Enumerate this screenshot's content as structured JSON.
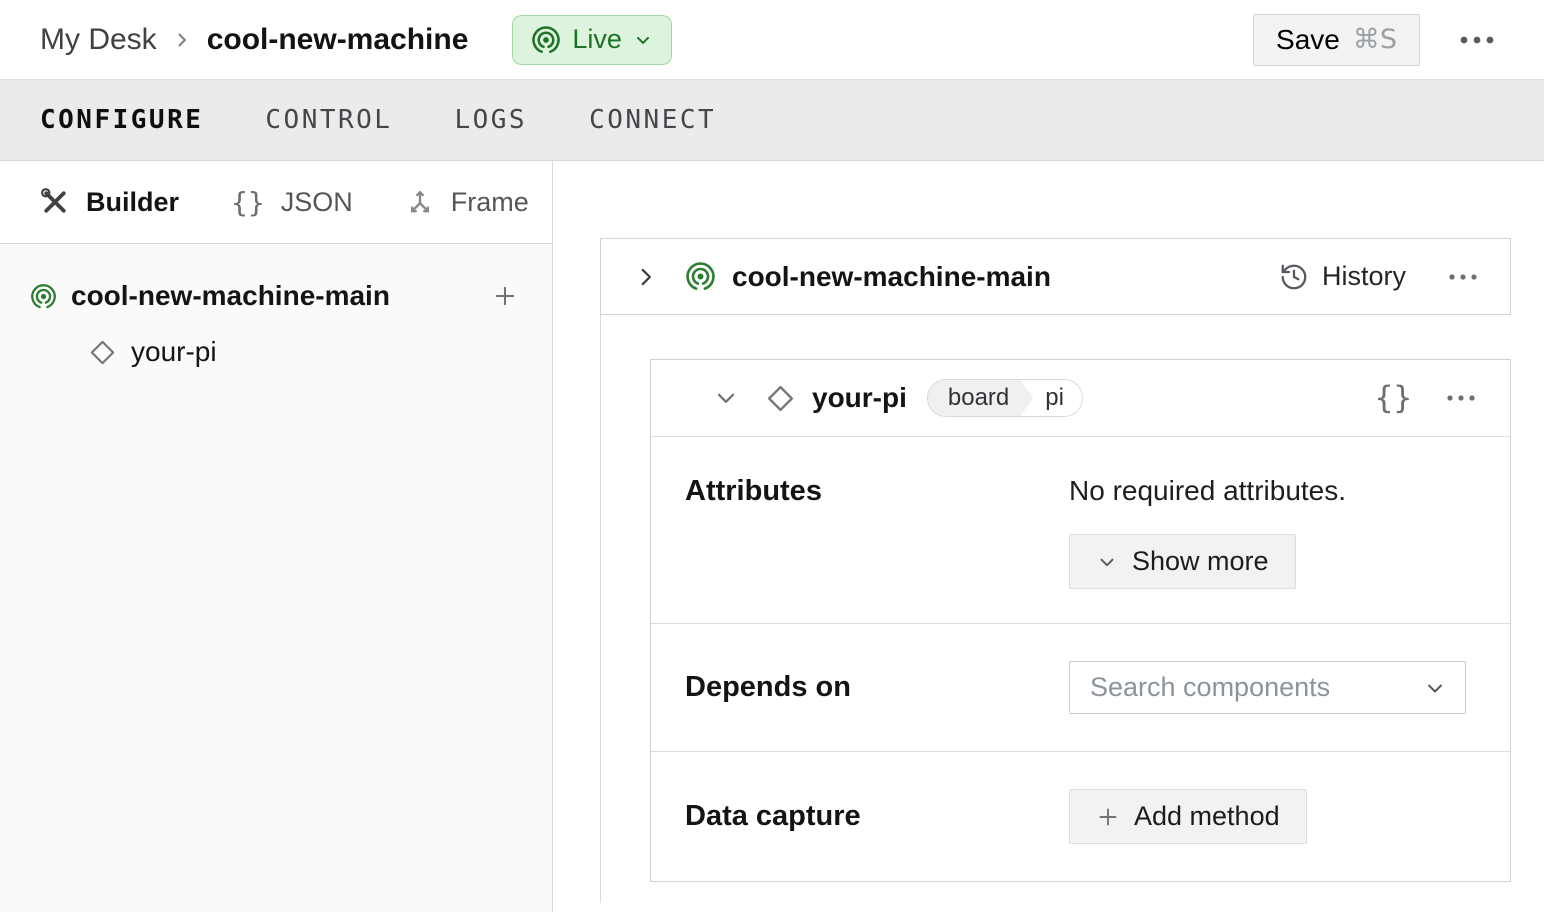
{
  "colors": {
    "accent_green": "#2b7d2f",
    "live_badge_bg": "#ddf3dd",
    "live_badge_border": "#a0d6a0",
    "live_badge_text": "#1d7325",
    "tabbar_bg": "#ebebeb",
    "sidebar_bg": "#fafafa",
    "card_border": "#d2d2d2"
  },
  "icons": {
    "braces": "{}"
  },
  "header": {
    "breadcrumb": {
      "parent": "My Desk",
      "current": "cool-new-machine"
    },
    "live_badge": {
      "label": "Live"
    },
    "save": {
      "label": "Save",
      "shortcut": "⌘S"
    }
  },
  "tabs": {
    "configure": "CONFIGURE",
    "control": "CONTROL",
    "logs": "LOGS",
    "connect": "CONNECT"
  },
  "sidebar": {
    "modes": {
      "builder": "Builder",
      "json": "JSON",
      "frame": "Frame"
    },
    "tree": {
      "part": {
        "label": "cool-new-machine-main"
      },
      "component": {
        "label": "your-pi"
      }
    }
  },
  "main": {
    "part_card": {
      "title": "cool-new-machine-main",
      "history": "History"
    },
    "component_card": {
      "title": "your-pi",
      "badge": {
        "type": "board",
        "model": "pi"
      },
      "attributes": {
        "label": "Attributes",
        "empty": "No required attributes.",
        "show_more": "Show more"
      },
      "depends_on": {
        "label": "Depends on",
        "placeholder": "Search components"
      },
      "data_capture": {
        "label": "Data capture",
        "add_method": "Add method"
      }
    }
  }
}
